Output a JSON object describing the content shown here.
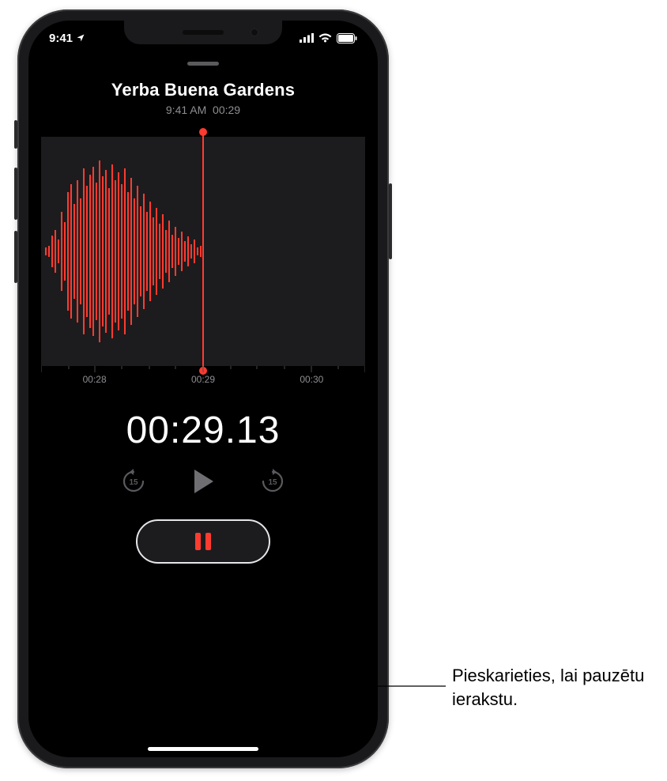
{
  "status": {
    "time": "9:41",
    "location_active": true
  },
  "recording": {
    "title": "Yerba Buena Gardens",
    "created_time": "9:41 AM",
    "duration_short": "00:29",
    "ruler": [
      "00:28",
      "00:29",
      "00:30"
    ],
    "elapsed": "00:29.13"
  },
  "callout": {
    "text": "Pieskarieties, lai pauzētu ierakstu."
  },
  "colors": {
    "accent": "#ff3b30"
  }
}
